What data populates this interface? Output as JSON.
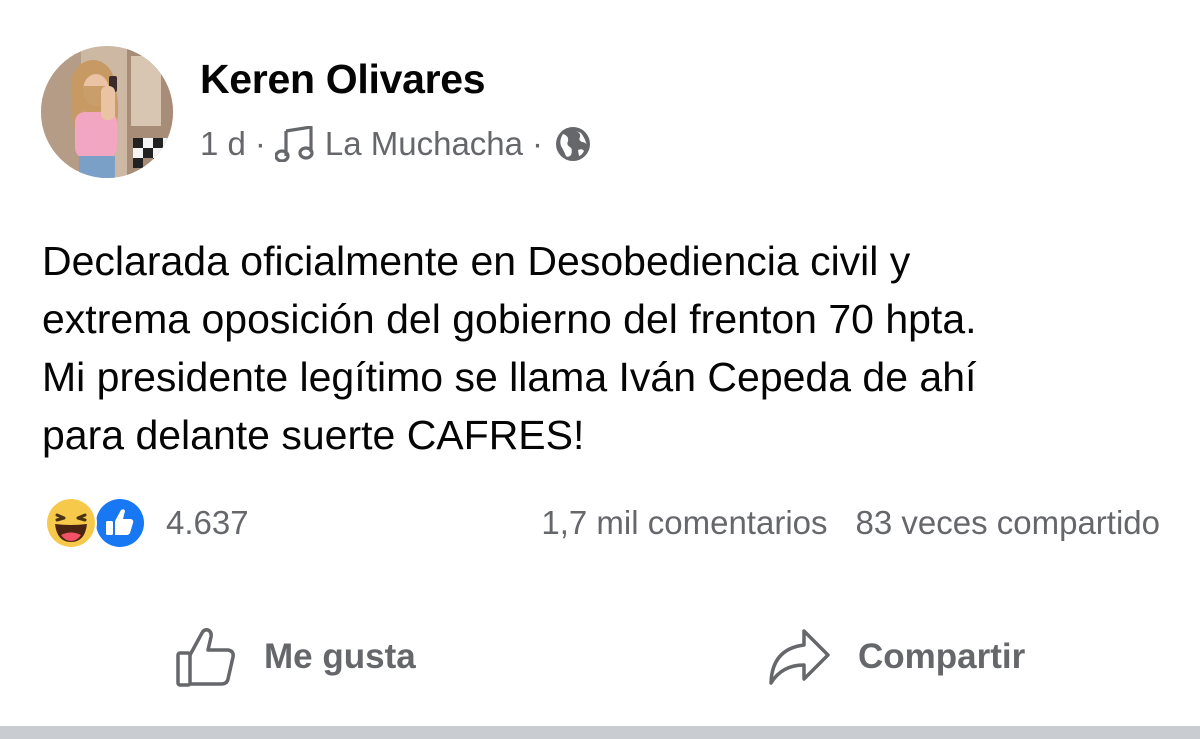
{
  "post": {
    "author": "Keren Olivares",
    "time": "1 d",
    "separator": "·",
    "music_label": "La Muchacha",
    "text_lines": [
      "Declarada oficialmente en Desobediencia civil y",
      "extrema oposición del gobierno del frenton 70 hpta.",
      "Mi presidente legítimo se llama Iván Cepeda de ahí",
      "para delante suerte CAFRES!"
    ],
    "privacy_icon": "globe-icon",
    "music_icon": "music-note-icon"
  },
  "stats": {
    "reaction_icons": [
      "haha-reaction-icon",
      "like-reaction-icon"
    ],
    "reaction_count": "4.637",
    "comments": "1,7 mil comentarios",
    "shares": "83 veces compartido"
  },
  "actions": {
    "like_label": "Me gusta",
    "share_label": "Compartir"
  },
  "colors": {
    "text_primary": "#050505",
    "text_secondary": "#65676b",
    "like_blue": "#1877f2",
    "haha_yellow": "#f7c94b",
    "divider": "#c9ccd1"
  }
}
